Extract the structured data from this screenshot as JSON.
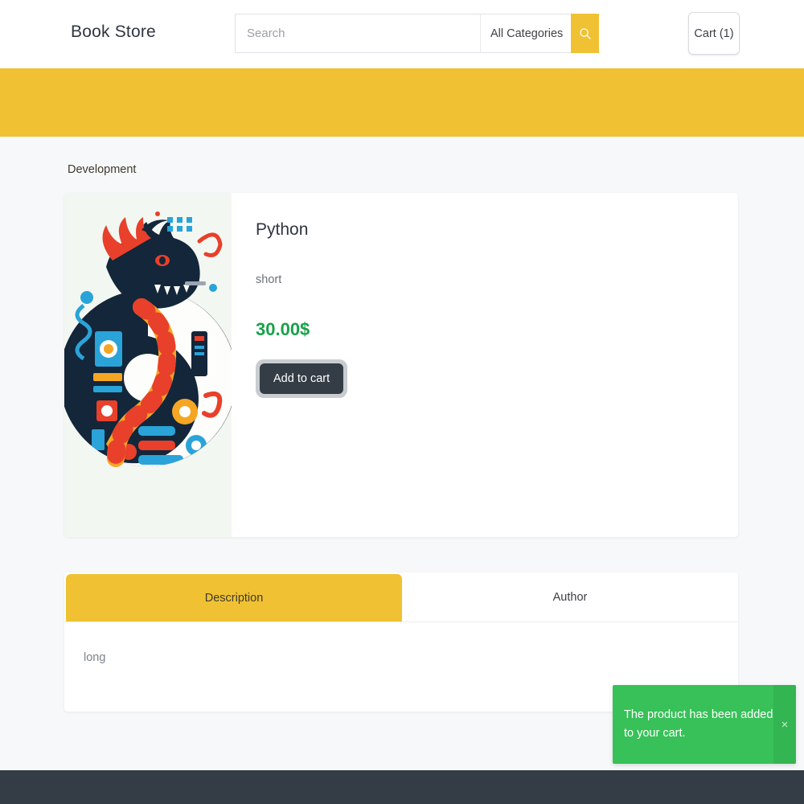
{
  "header": {
    "brand": "Book Store",
    "search": {
      "placeholder": "Search",
      "value": "",
      "category_selected": "All Categories",
      "search_icon": "search-icon"
    },
    "cart_label": "Cart (1)"
  },
  "nav": {
    "items": [
      {
        "label": "Development"
      }
    ]
  },
  "product": {
    "title": "Python",
    "short_description": "short",
    "price": "30.00$",
    "add_to_cart_label": "Add to cart",
    "image_alt": "python-dragon-tech-illustration"
  },
  "tabs": {
    "items": [
      {
        "label": "Description",
        "active": true
      },
      {
        "label": "Author",
        "active": false
      }
    ],
    "body_text": "long"
  },
  "toast": {
    "message": "The product has been added to your cart.",
    "close_label": "×",
    "color": "#37c158"
  },
  "colors": {
    "brand_yellow": "#f0c233",
    "price_green": "#17a24a",
    "dark": "#343d46",
    "page_bg": "#f7f8fa"
  }
}
